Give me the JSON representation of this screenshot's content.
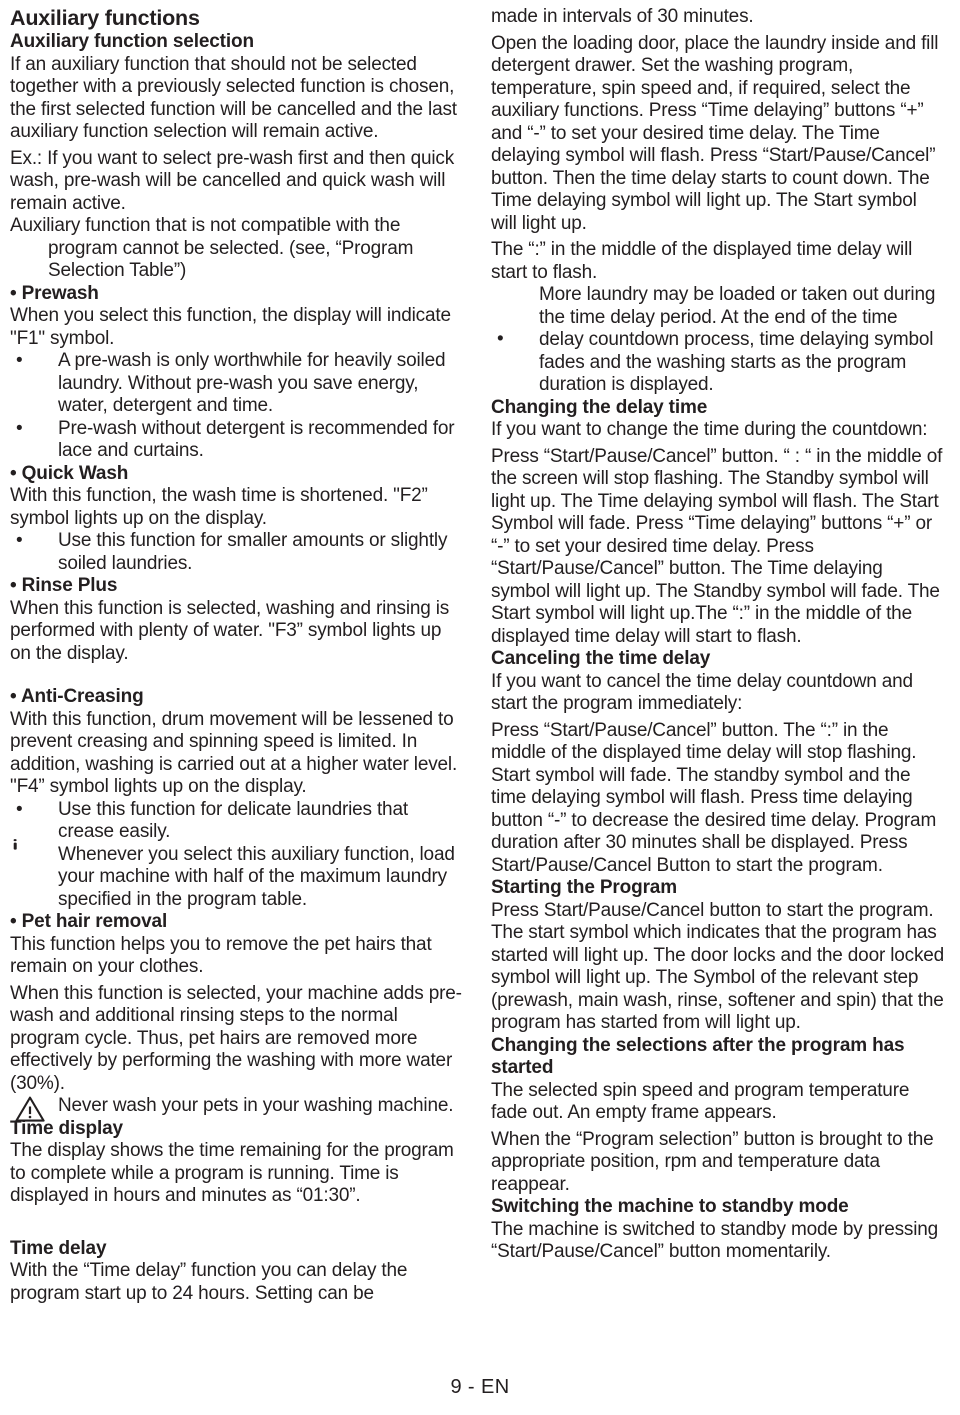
{
  "document": {
    "footer": "9 - EN",
    "text_color": "#231f20",
    "background_color": "#ffffff"
  },
  "left_column": {
    "title": "Auxiliary functions",
    "subtitle": "Auxiliary function selection",
    "intro": "If an auxiliary function that should not be selected together with a previously selected function is chosen, the first selected function will be cancelled and the last auxiliary function selection will remain active.",
    "example": "Ex.: If you want to select pre-wash first and then quick wash, pre-wash will be cancelled and quick wash will remain active.",
    "not_compatible": "Auxiliary function that is not compatible with the program cannot be selected. (see, “Program Selection Table”)",
    "prewash": {
      "heading": "Prewash",
      "bullet_char": "•",
      "body": "When you select this function, the display will indicate \"F1\" symbol.",
      "items": [
        "A pre-wash is only worthwhile for heavily soiled laundry. Without pre-wash you save energy, water, detergent and time.",
        "Pre-wash without detergent is recommended for lace and curtains."
      ]
    },
    "quick_wash": {
      "heading": "Quick Wash",
      "body": "With this function, the wash time is shortened. \"F2” symbol lights up on the display.",
      "items": [
        "Use this function for smaller amounts or slightly soiled laundries."
      ]
    },
    "rinse_plus": {
      "heading": "Rinse Plus",
      "body": "When this function is selected, washing and rinsing is performed with plenty of water. \"F3” symbol lights up on the display."
    },
    "anti_creasing": {
      "heading": "Anti-Creasing",
      "body": "With this function, drum movement will be lessened to prevent creasing and spinning speed is limited. In addition, washing is carried out at a higher water level. \"F4” symbol lights up on the display.",
      "items": [
        "Use this function for delicate laundries that crease easily."
      ],
      "info_note": "Whenever you select this auxiliary function, load your machine with half of the maximum laundry specified in the program table."
    },
    "pet_hair": {
      "heading": "Pet hair removal",
      "body1": "This function helps you to remove the pet hairs that remain on your clothes.",
      "body2": "When this function is selected, your machine adds pre-wash and additional rinsing steps to the normal program cycle. Thus, pet hairs are removed more effectively by performing the washing with more water (30%).",
      "warning_note": "Never wash your pets in your washing machine."
    },
    "time_display": {
      "heading": "Time display",
      "body": "The display shows the time remaining for the program to complete while a program is running. Time is displayed in hours and minutes as “01:30”."
    },
    "time_delay": {
      "heading": "Time delay",
      "body": "With the “Time delay” function you can delay the program start up to 24 hours. Setting can be"
    }
  },
  "right_column": {
    "continued": "made in intervals of 30 minutes.",
    "setup": "Open the loading door, place the laundry inside and fill detergent drawer. Set the washing program, temperature, spin speed and, if required, select the auxiliary functions. Press “Time delaying” buttons “+” and “-” to set your desired time delay. The Time delaying symbol will flash. Press “Start/Pause/Cancel” button. Then the time delay starts to count down. The Time delaying symbol will light up. The Start symbol will light up.",
    "flash_note": "The “:” in the middle of the displayed time delay will start to flash.",
    "bullet_char": "•",
    "bullet_item": "More laundry may be loaded or taken out during the time delay period. At the end of the time delay countdown process, time delaying symbol fades and the washing starts as the program duration is displayed.",
    "changing_delay": {
      "heading": "Changing the delay time",
      "lead": "If you want to change the time during the countdown:",
      "body": "Press “Start/Pause/Cancel” button. “ : “ in the middle of the screen will stop flashing. The Standby symbol will light up. The Time delaying symbol will flash. The Start Symbol will fade. Press “Time delaying” buttons “+” or “-” to set your desired time delay. Press “Start/Pause/Cancel” button. The Time delaying symbol will light up. The Standby symbol will fade. The Start symbol will light up.The “:” in the middle of the displayed time delay will start to flash."
    },
    "canceling_delay": {
      "heading": "Canceling the time delay",
      "lead": "If you want to cancel the time delay countdown and start the program immediately:",
      "body": "Press “Start/Pause/Cancel” button. The “:” in the middle of the displayed time delay will stop flashing. Start symbol will fade. The standby symbol and the time delaying symbol will flash. Press time delaying button “-” to decrease the desired time delay. Program duration after 30 minutes shall be displayed. Press Start/Pause/Cancel Button to start the program."
    },
    "starting_program": {
      "heading": "Starting the Program",
      "body": "Press Start/Pause/Cancel button to start the program. The start symbol which indicates that the program has started will light up. The door locks and the door locked symbol will light up. The Symbol of the relevant step (prewash, main wash, rinse, softener and spin) that the program has started from will light up."
    },
    "changing_selections": {
      "heading": "Changing the selections after the program has started",
      "body1": "The selected spin speed and program temperature fade out. An empty frame appears.",
      "body2": "When the “Program selection” button is brought to the appropriate position, rpm and temperature data reappear."
    },
    "standby_mode": {
      "heading": "Switching the machine to standby mode",
      "body": "The machine is switched to standby mode by pressing “Start/Pause/Cancel” button momentarily."
    }
  }
}
